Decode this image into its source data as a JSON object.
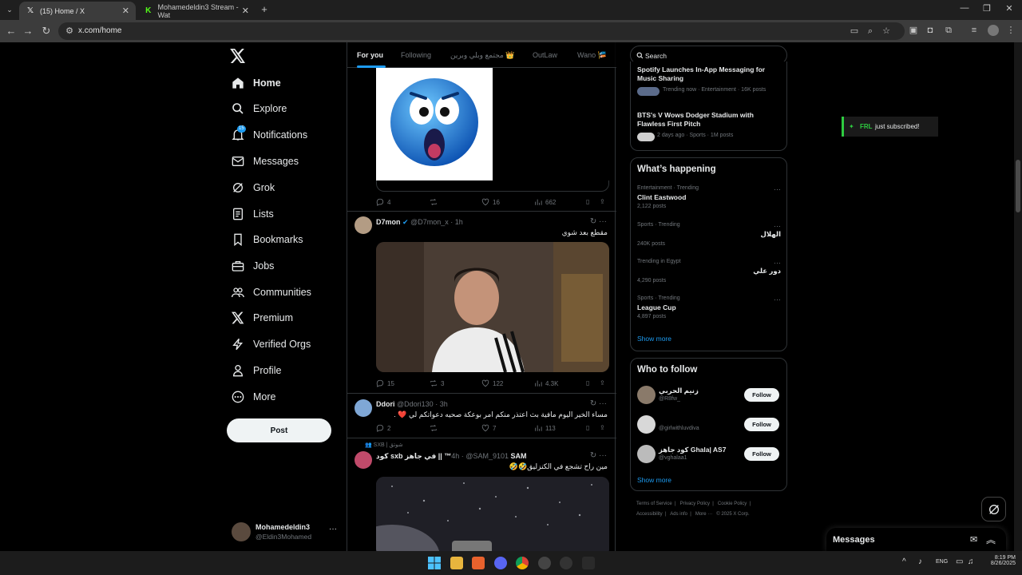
{
  "browser": {
    "tabs": [
      {
        "title": "(15) Home / X",
        "active": true
      },
      {
        "title": "Mohamedeldin3 Stream - Wat",
        "active": false
      }
    ],
    "url": "x.com/home"
  },
  "sidebar": {
    "items": [
      {
        "label": "Home",
        "icon": "home-icon"
      },
      {
        "label": "Explore",
        "icon": "search-icon"
      },
      {
        "label": "Notifications",
        "icon": "bell-icon",
        "badge": "15"
      },
      {
        "label": "Messages",
        "icon": "envelope-icon"
      },
      {
        "label": "Grok",
        "icon": "grok-icon"
      },
      {
        "label": "Lists",
        "icon": "list-icon"
      },
      {
        "label": "Bookmarks",
        "icon": "bookmark-icon"
      },
      {
        "label": "Jobs",
        "icon": "briefcase-icon"
      },
      {
        "label": "Communities",
        "icon": "people-icon"
      },
      {
        "label": "Premium",
        "icon": "x-logo-icon"
      },
      {
        "label": "Verified Orgs",
        "icon": "lightning-icon"
      },
      {
        "label": "Profile",
        "icon": "person-icon"
      },
      {
        "label": "More",
        "icon": "more-circle-icon"
      }
    ],
    "post_label": "Post",
    "account": {
      "name": "Mohamedeldin3",
      "handle": "@Eldin3Mohamed"
    }
  },
  "feed": {
    "tabs": [
      "For you",
      "Following",
      "مجتمع وبلي وبرين 👑",
      "OutLaw",
      "Wano 🎏"
    ],
    "overlay": {
      "name": "FRL",
      "text": "just subscribed!"
    },
    "posts": [
      {
        "replies": "4",
        "reposts": "",
        "likes": "16",
        "views": "662"
      },
      {
        "name": "D7mon",
        "handle": "@D7mon_x",
        "time": "1h",
        "text": "مقطع بعد شوي",
        "replies": "15",
        "reposts": "3",
        "likes": "122",
        "views": "4.3K"
      },
      {
        "name": "Ddori",
        "handle": "@Ddori130",
        "time": "3h",
        "text": "مساء الخير اليوم مافية بث اعتذر منكم امر بوعكة صحيه دعواتكم لي ❤️ .",
        "replies": "2",
        "reposts": "",
        "likes": "7",
        "views": "113"
      },
      {
        "context": "SXB | شوتق",
        "name": "SAM™ || في جاهز sxb كود",
        "handle": "@SAM_9101",
        "time": "4h",
        "text": "مين راح تشجع في الكنزليق🤣🤣"
      }
    ]
  },
  "right": {
    "search_placeholder": "Search",
    "news": [
      {
        "title": "Spotify Launches In-App Messaging for Music Sharing",
        "meta": "Trending now · Entertainment · 16K posts"
      },
      {
        "title": "BTS's V Wows Dodger Stadium with Flawless First Pitch",
        "meta": "2 days ago · Sports · 1M posts"
      }
    ],
    "happening_title": "What’s happening",
    "trends": [
      {
        "context": "Entertainment · Trending",
        "name": "Clint Eastwood",
        "posts": "2,122 posts"
      },
      {
        "context": "Sports · Trending",
        "name": "الهلال",
        "posts": "240K posts"
      },
      {
        "context": "Trending in Egypt",
        "name": "دور علي",
        "posts": "4,290 posts"
      },
      {
        "context": "Sports · Trending",
        "name": "League Cup",
        "posts": "4,897 posts"
      }
    ],
    "show_more": "Show more",
    "who_title": "Who to follow",
    "follow_label": "Follow",
    "who": [
      {
        "name": "زنيم الحربي",
        "handle": "@R8fw_"
      },
      {
        "name": "",
        "handle": "@girlwithluvdiva"
      },
      {
        "name": "كود جاهز Ghala| AS7",
        "handle": "@vghalaa1"
      }
    ],
    "footer": [
      "Terms of Service",
      "|",
      "Privacy Policy",
      "|",
      "Cookie Policy",
      "|",
      "Accessibility",
      "|",
      "Ads info",
      "|",
      "More ···",
      "© 2025 X Corp."
    ]
  },
  "messages_drawer": {
    "title": "Messages"
  },
  "taskbar": {
    "lang": "ENG",
    "time": "8:19 PM",
    "date": "8/26/2025"
  },
  "colors": {
    "accent": "#1d9bf0",
    "bg": "#000000",
    "border": "#2f3336"
  }
}
